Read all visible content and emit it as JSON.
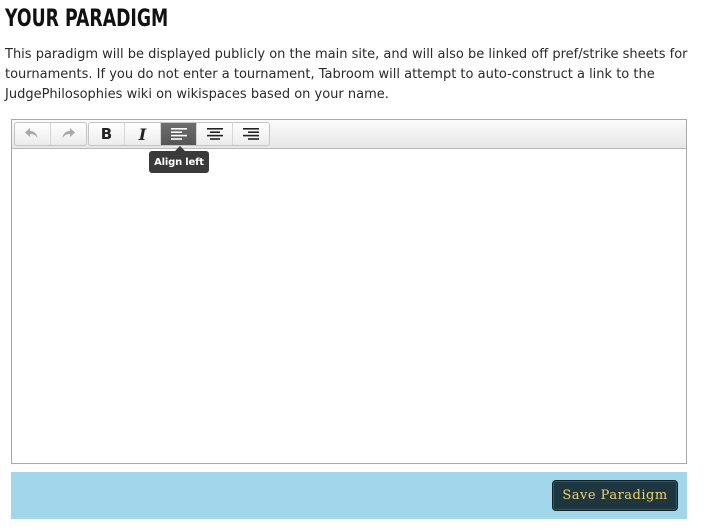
{
  "page": {
    "title": "YOUR PARADIGM",
    "intro": "This paradigm will be displayed publicly on the main site, and will also be linked off pref/strike sheets for tournaments. If you do not enter a tournament, Tabroom will attempt to auto-construct a link to the JudgePhilosophies wiki on wikispaces based on your name."
  },
  "toolbar": {
    "undo_icon": "undo-icon",
    "redo_icon": "redo-icon",
    "bold_label": "B",
    "italic_label": "I",
    "align_left_icon": "align-left-icon",
    "align_center_icon": "align-center-icon",
    "align_right_icon": "align-right-icon",
    "active_button": "align-left"
  },
  "tooltip": {
    "text": "Align left"
  },
  "editor": {
    "content": ""
  },
  "save": {
    "label": "Save Paradigm"
  },
  "colors": {
    "save_bar": "#a2d6ea",
    "save_button_bg": "#1e3640",
    "save_button_text": "#f2d26a",
    "active_tool": "#5e5e5e"
  }
}
